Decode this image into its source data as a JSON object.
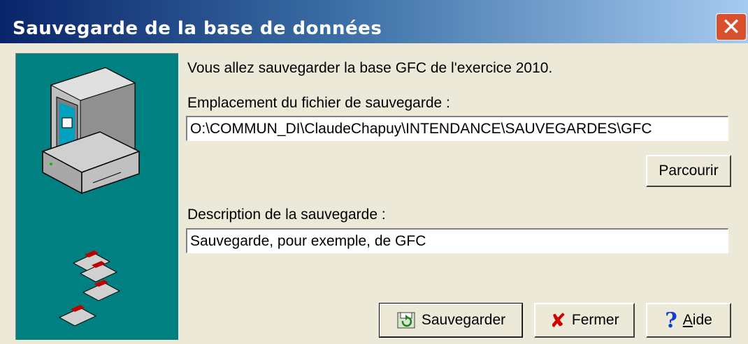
{
  "window": {
    "title": "Sauvegarde de la base de données"
  },
  "intro": "Vous allez sauvegarder la base GFC de l'exercice 2010.",
  "location": {
    "label": "Emplacement du fichier de sauvegarde :",
    "value": "O:\\COMMUN_DI\\ClaudeChapuy\\INTENDANCE\\SAUVEGARDES\\GFC",
    "browse_label": "Parcourir"
  },
  "description": {
    "label": "Description de la sauvegarde :",
    "value": "Sauvegarde, pour exemple, de GFC"
  },
  "buttons": {
    "save": {
      "label": "Sauvegarder",
      "icon": "save-icon"
    },
    "close": {
      "label": "Fermer",
      "icon": "red-x-icon"
    },
    "help": {
      "label_accel": "A",
      "label_rest": "ide",
      "icon": "question-icon"
    }
  },
  "colors": {
    "panel": "#008080",
    "face": "#ece9d8"
  }
}
